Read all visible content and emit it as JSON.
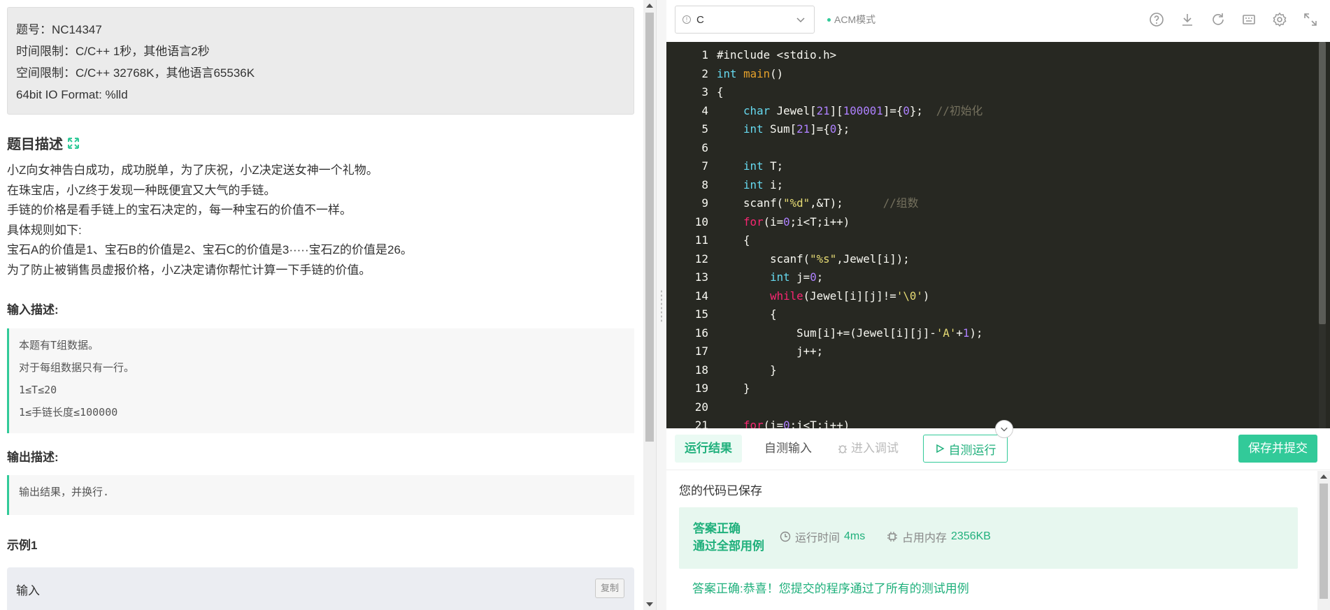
{
  "problem_info": {
    "id_line": "题号：NC14347",
    "time_limit": "时间限制：C/C++ 1秒，其他语言2秒",
    "space_limit": "空间限制：C/C++ 32768K，其他语言65536K",
    "io_format": "64bit IO Format: %lld"
  },
  "description": {
    "title": "题目描述",
    "lines": [
      "小Z向女神告白成功，成功脱单，为了庆祝，小Z决定送女神一个礼物。",
      "在珠宝店，小Z终于发现一种既便宜又大气的手链。",
      "手链的价格是看手链上的宝石决定的，每一种宝石的价值不一样。",
      "具体规则如下:",
      "宝石A的价值是1、宝石B的价值是2、宝石C的价值是3·····宝石Z的价值是26。",
      "为了防止被销售员虚报价格，小Z决定请你帮忙计算一下手链的价值。"
    ]
  },
  "input_desc": {
    "title": "输入描述:",
    "lines": [
      "本题有T组数据。",
      "对于每组数据只有一行。",
      "1≤T≤20",
      "1≤手链长度≤100000"
    ]
  },
  "output_desc": {
    "title": "输出描述:",
    "lines": [
      "输出结果，并换行."
    ]
  },
  "example": {
    "title": "示例1",
    "input_label": "输入",
    "copy_label": "复制"
  },
  "toolbar": {
    "language": "C",
    "mode": "ACM模式",
    "icons": [
      "help-icon",
      "download-icon",
      "refresh-icon",
      "keyboard-icon",
      "settings-icon",
      "fullscreen-icon"
    ]
  },
  "editor": {
    "line_numbers": [
      "1",
      "2",
      "3",
      "4",
      "5",
      "6",
      "7",
      "8",
      "9",
      "10",
      "11",
      "12",
      "13",
      "14",
      "15",
      "16",
      "17",
      "18",
      "19",
      "20",
      "21"
    ],
    "code_lines": [
      "#include <stdio.h>",
      "int main()",
      "{",
      "    char Jewel[21][100001]={0};  //初始化",
      "    int Sum[21]={0};",
      "",
      "    int T;",
      "    int i;",
      "    scanf(\"%d\",&T);      //组数",
      "    for(i=0;i<T;i++)",
      "    {",
      "        scanf(\"%s\",Jewel[i]);",
      "        int j=0;",
      "        while(Jewel[i][j]!='\\0')",
      "        {",
      "            Sum[i]+=(Jewel[i][j]-'A'+1);",
      "            j++;",
      "        }",
      "    }",
      "",
      "    for(i=0;i<T;i++)"
    ]
  },
  "tabs": {
    "result": "运行结果",
    "self_input": "自测输入",
    "debug": "进入调试",
    "run": "自测运行",
    "submit": "保存并提交"
  },
  "result": {
    "saved": "您的代码已保存",
    "verdict_line1": "答案正确",
    "verdict_line2": "通过全部用例",
    "time_label": "运行时间",
    "time_value": "4ms",
    "mem_label": "占用内存",
    "mem_value": "2356KB",
    "final_message": "答案正确:恭喜！您提交的程序通过了所有的测试用例"
  },
  "colors": {
    "accent": "#32ca99",
    "editor_bg": "#272822"
  }
}
